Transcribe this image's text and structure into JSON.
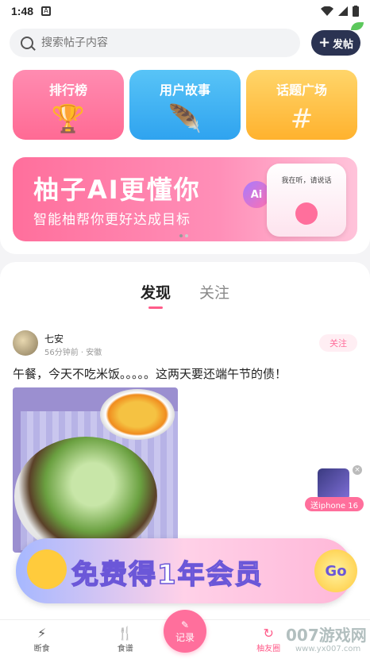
{
  "status_bar": {
    "time": "1:48"
  },
  "search": {
    "placeholder": "搜索帖子内容"
  },
  "post_button": {
    "label": "发帖"
  },
  "categories": [
    {
      "label": "排行榜",
      "icon": "trophy-icon"
    },
    {
      "label": "用户故事",
      "icon": "feather-icon"
    },
    {
      "label": "话题广场",
      "icon": "hash-icon"
    }
  ],
  "banner": {
    "title": "柚子AI更懂你",
    "subtitle": "智能柚帮你更好达成目标",
    "card_text": "我在听，请说话",
    "ai_badge": "Ai"
  },
  "feed": {
    "tabs": [
      {
        "label": "发现",
        "active": true
      },
      {
        "label": "关注",
        "active": false
      }
    ],
    "post": {
      "username": "七安",
      "meta": "56分钟前 · 安徽",
      "follow_label": "关注",
      "text": "午餐，今天不吃米饭。。。。。这两天要还端午节的债！"
    }
  },
  "promo": {
    "text": "免费得1年会员",
    "go": "Go"
  },
  "float_ad": {
    "label": "送iphone 16",
    "close": "×"
  },
  "bottom_nav": {
    "items": [
      {
        "label": "断食",
        "icon": "lightning-icon"
      },
      {
        "label": "食谱",
        "icon": "fork-knife-icon"
      },
      {
        "label": "柚友圈",
        "icon": "refresh-icon",
        "active": true
      }
    ],
    "record_label": "记录"
  },
  "watermark": {
    "main": "007游戏网",
    "sub": "www.yx007.com"
  },
  "colors": {
    "accent": "#ff6f9c",
    "post_button": "#2b3352"
  }
}
